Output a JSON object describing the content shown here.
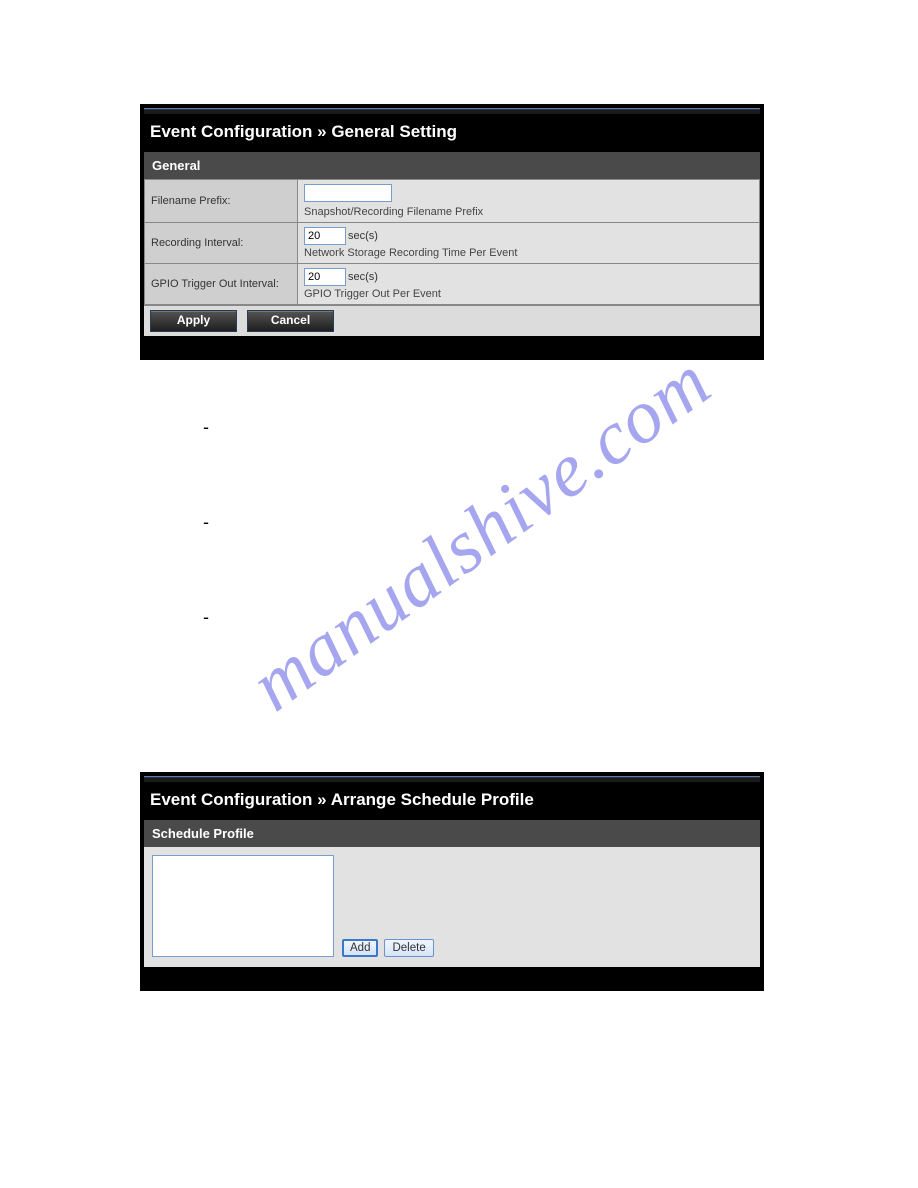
{
  "panel1": {
    "heading": "Event Configuration » General Setting",
    "section": "General",
    "rows": {
      "filename": {
        "label": "Filename Prefix:",
        "value": "",
        "hint": "Snapshot/Recording Filename Prefix"
      },
      "recInterval": {
        "label": "Recording Interval:",
        "value": "20",
        "unit": "sec(s)",
        "hint": "Network Storage Recording Time Per Event"
      },
      "gpio": {
        "label": "GPIO Trigger Out Interval:",
        "value": "20",
        "unit": "sec(s)",
        "hint": "GPIO Trigger Out Per Event"
      }
    },
    "buttons": {
      "apply": "Apply",
      "cancel": "Cancel"
    }
  },
  "panel2": {
    "heading": "Event Configuration » Arrange Schedule Profile",
    "section": "Schedule Profile",
    "buttons": {
      "add": "Add",
      "delete": "Delete"
    }
  },
  "watermark": "manualshive.com"
}
